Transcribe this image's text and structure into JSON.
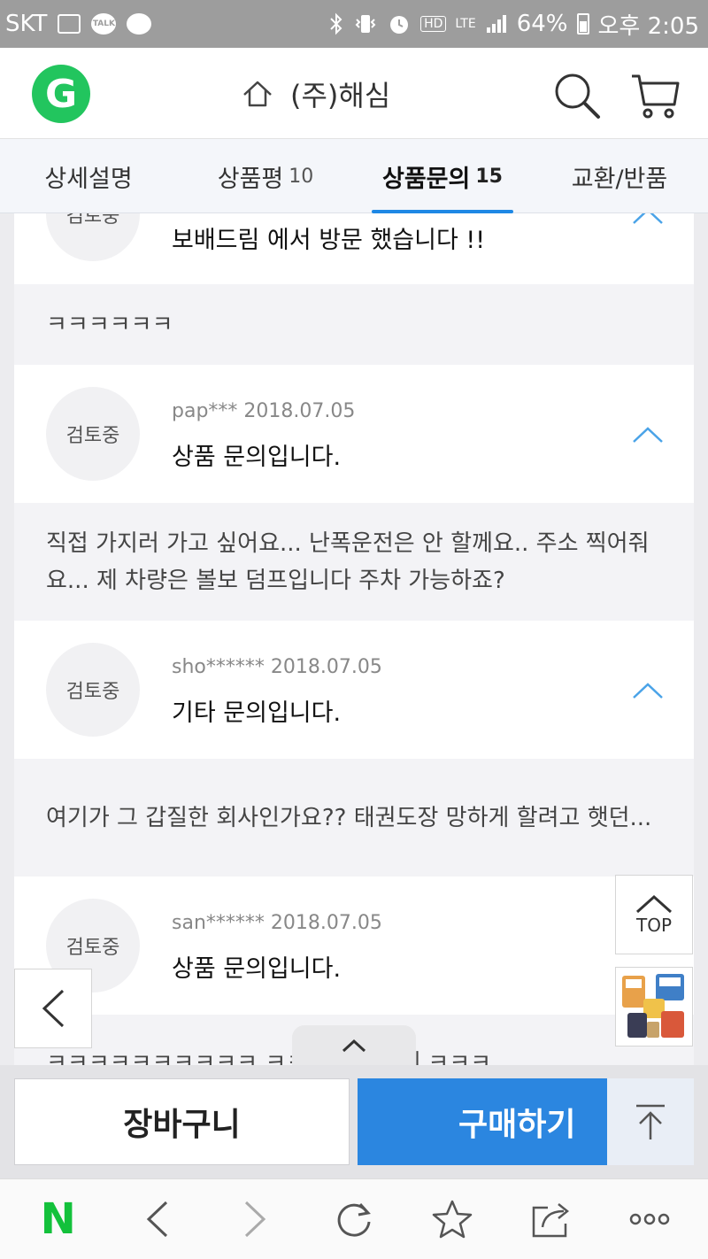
{
  "status_bar": {
    "carrier": "SKT",
    "talk_badge": "TALK",
    "hd_badge": "HD",
    "lte_badge": "LTE",
    "battery": "64%",
    "time": "오후 2:05"
  },
  "header": {
    "logo_letter": "G",
    "store_name": "(주)해심",
    "brand_color": "#22c55e"
  },
  "tabs": [
    {
      "label": "상세설명",
      "count": ""
    },
    {
      "label": "상품평",
      "count": "10"
    },
    {
      "label": "상품문의",
      "count": "15"
    },
    {
      "label": "교환/반품",
      "count": ""
    }
  ],
  "active_tab": "상품문의",
  "inquiries": [
    {
      "status": "검토중",
      "meta": "",
      "title": "보배드림 에서 방문 했습니다 !!",
      "body": "ㅋㅋㅋㅋㅋㅋ"
    },
    {
      "status": "검토중",
      "meta": "pap*** 2018.07.05",
      "title": "상품 문의입니다.",
      "body": "직접 가지러 가고 싶어요... 난폭운전은 안 할께요.. 주소 찍어줘요... 제 차량은 볼보 덤프입니다 주차 가능하죠?"
    },
    {
      "status": "검토중",
      "meta": "sho****** 2018.07.05",
      "title": "기타 문의입니다.",
      "body": "여기가 그 갑질한 회사인가요?? 태권도장 망하게 할려고 햇던..."
    },
    {
      "status": "검토중",
      "meta": "san****** 2018.07.05",
      "title": "상품 문의입니다.",
      "body": "ㅋㅋㅋㅋㅋㅋㅋㅋㅋㅋ ㅋㅋㅋ 망카페에 ㅋㅋㅋ"
    }
  ],
  "floating": {
    "top_label": "TOP"
  },
  "actions": {
    "cart_label": "장바구니",
    "buy_label": "구매하기",
    "buy_color": "#2b86e0"
  },
  "browser_bar": {
    "logo_letter": "N",
    "icons": [
      "back-icon",
      "forward-icon",
      "refresh-icon",
      "star-icon",
      "share-icon",
      "more-icon"
    ]
  }
}
